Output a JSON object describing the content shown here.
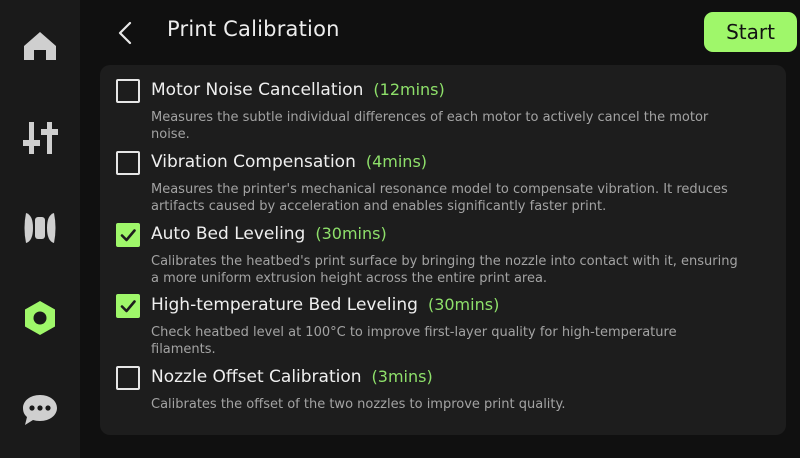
{
  "sidebar": {
    "items": [
      {
        "name": "home",
        "icon": "home-icon",
        "active": false
      },
      {
        "name": "controls",
        "icon": "sliders-icon",
        "active": false
      },
      {
        "name": "filament",
        "icon": "filament-spool-icon",
        "active": false
      },
      {
        "name": "settings",
        "icon": "hex-nut-icon",
        "active": true
      },
      {
        "name": "messages",
        "icon": "chat-bubble-icon",
        "active": false
      }
    ],
    "active_color": "#9ff76a",
    "icon_color": "#cfcfcf"
  },
  "header": {
    "back_icon": "chevron-left-icon",
    "title": "Print Calibration",
    "start_label": "Start"
  },
  "colors": {
    "accent": "#9ff76a",
    "duration": "#8ee06a",
    "panel": "#1d1d1d",
    "background": "#101010"
  },
  "options": [
    {
      "title": "Motor Noise Cancellation",
      "duration": "(12mins)",
      "checked": false,
      "description": "Measures the subtle individual differences of each motor to actively cancel the motor noise."
    },
    {
      "title": "Vibration Compensation",
      "duration": "(4mins)",
      "checked": false,
      "description": "Measures the printer's mechanical resonance model to compensate vibration. It reduces artifacts caused by acceleration and enables significantly faster print."
    },
    {
      "title": "Auto Bed Leveling",
      "duration": "(30mins)",
      "checked": true,
      "description": "Calibrates the heatbed's print surface by bringing the nozzle into contact with it, ensuring a more uniform extrusion height across the entire print area."
    },
    {
      "title": "High-temperature Bed Leveling",
      "duration": "(30mins)",
      "checked": true,
      "description": "Check heatbed level at 100°C to improve first-layer quality for high-temperature filaments."
    },
    {
      "title": "Nozzle Offset Calibration",
      "duration": "(3mins)",
      "checked": false,
      "description": "Calibrates the offset of the two nozzles to improve print quality."
    }
  ]
}
